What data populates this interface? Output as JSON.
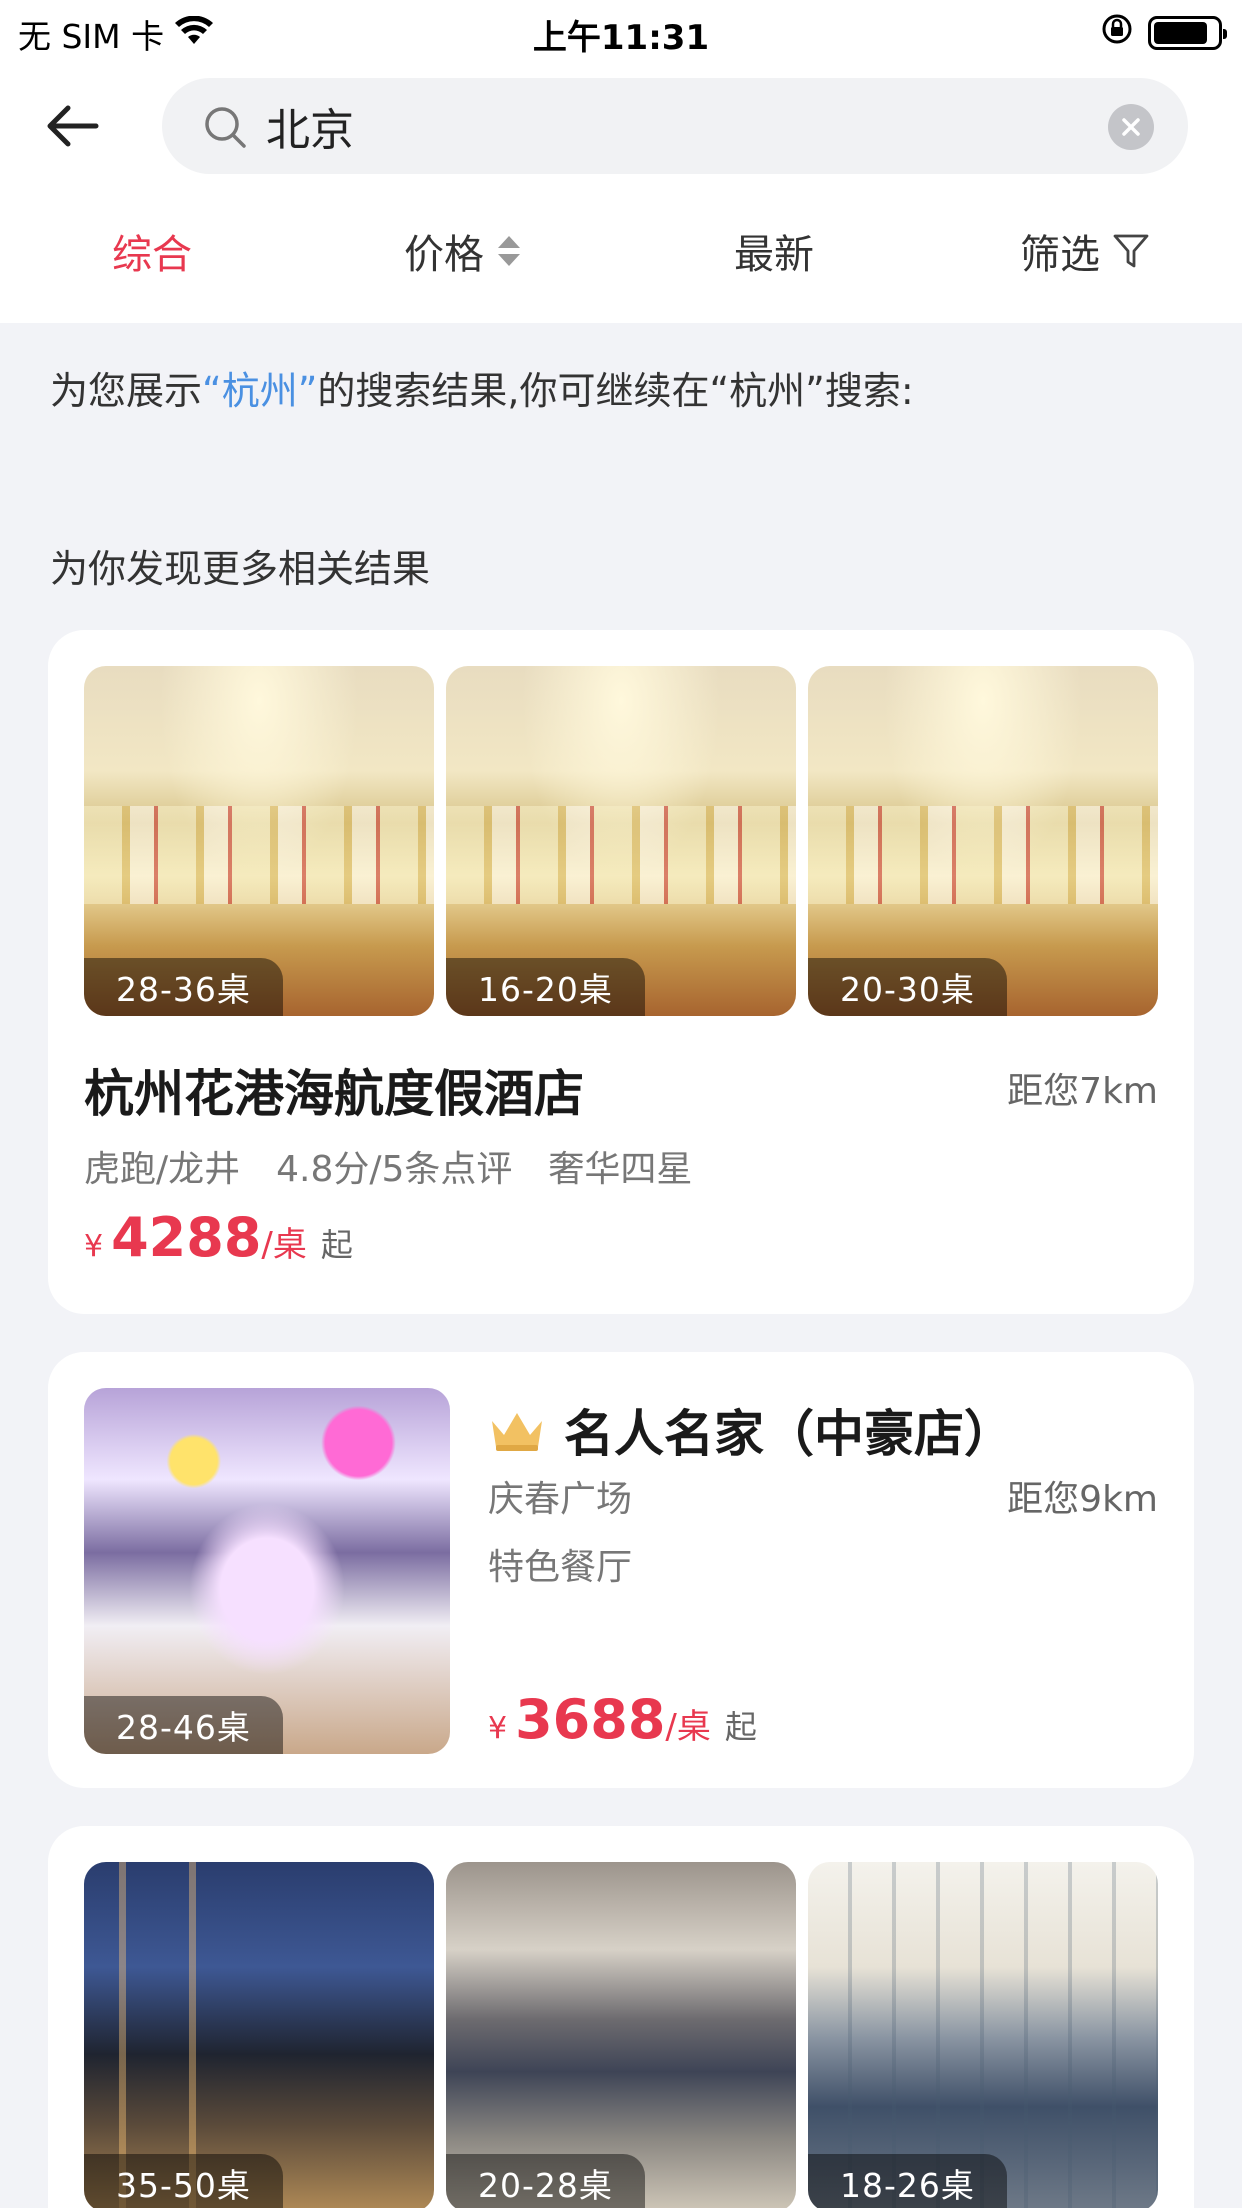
{
  "status_bar": {
    "carrier": "无 SIM 卡",
    "time": "上午11:31"
  },
  "search": {
    "query": "北京"
  },
  "tabs": [
    {
      "label": "综合"
    },
    {
      "label": "价格"
    },
    {
      "label": "最新"
    },
    {
      "label": "筛选"
    }
  ],
  "hint": {
    "prefix": "为您展示",
    "city": "“杭州”",
    "middle": "的搜索结果,你可继续在“杭州”搜索:",
    "more": "为你发现更多相关结果"
  },
  "listings": [
    {
      "images": [
        {
          "label": "28-36桌"
        },
        {
          "label": "16-20桌"
        },
        {
          "label": "20-30桌"
        }
      ],
      "name": "杭州花港海航度假酒店",
      "distance": "距您7km",
      "meta": "虎跑/龙井　4.8分/5条点评　奢华四星",
      "price": {
        "currency": "¥",
        "amount": "4288",
        "unit": "/桌",
        "suffix": "起"
      }
    },
    {
      "images": [
        {
          "label": "28-46桌"
        }
      ],
      "name": "名人名家（中豪店）",
      "area": "庆春广场",
      "distance": "距您9km",
      "category": "特色餐厅",
      "price": {
        "currency": "¥",
        "amount": "3688",
        "unit": "/桌",
        "suffix": "起"
      }
    },
    {
      "images": [
        {
          "label": "35-50桌"
        },
        {
          "label": "20-28桌"
        },
        {
          "label": "18-26桌"
        }
      ]
    }
  ],
  "colors": {
    "accent": "#e8384f",
    "link": "#4a90e2",
    "background": "#f2f3f7"
  }
}
